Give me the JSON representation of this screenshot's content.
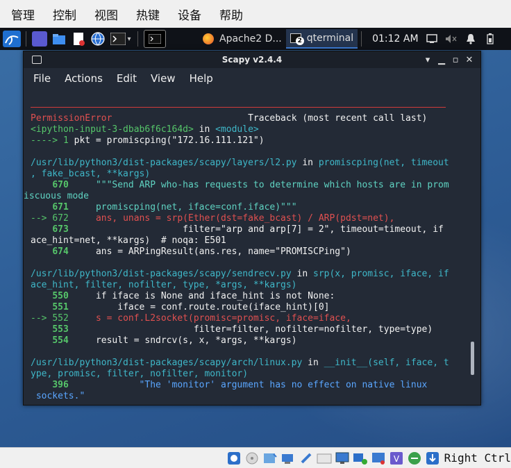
{
  "host_menu": {
    "items": [
      "管理",
      "控制",
      "视图",
      "热键",
      "设备",
      "帮助"
    ]
  },
  "panel": {
    "tasks": [
      {
        "label": "Apache2 D...",
        "icon": "firefox-icon"
      },
      {
        "label": "qterminal",
        "icon": "terminal-icon",
        "badge": "2"
      }
    ],
    "clock": "01:12 AM"
  },
  "window": {
    "title": "Scapy v2.4.4",
    "menu": [
      "File",
      "Actions",
      "Edit",
      "View",
      "Help"
    ]
  },
  "terminal": {
    "error_name": "PermissionError",
    "traceback_label": "Traceback (most recent call last)",
    "frames": [
      {
        "header": [
          "<ipython-input-3-dbab6f6c164d>",
          " in ",
          "<module>"
        ],
        "lines": [
          {
            "marker": "----> ",
            "num": "1",
            "code": "pkt = promiscping(\"172.16.111.121\")"
          }
        ]
      },
      {
        "path": "/usr/lib/python3/dist-packages/scapy/layers/l2.py",
        "func": "promiscping(net, timeout",
        "func_cont": ", fake_bcast, **kargs)",
        "lines": [
          {
            "marker": "    ",
            "num": "670",
            "code": "\"\"\"Send ARP who-has requests to determine which hosts are in prom"
          },
          {
            "marker": "",
            "num": "",
            "code": "iscuous mode"
          },
          {
            "marker": "    ",
            "num": "671",
            "code": "promiscping(net, iface=conf.iface)\"\"\""
          },
          {
            "marker": "--> ",
            "num": "672",
            "code": "ans, unans = srp(Ether(dst=fake_bcast) / ARP(pdst=net),"
          },
          {
            "marker": "    ",
            "num": "673",
            "code": "                filter=\"arp and arp[7] = 2\", timeout=timeout, if"
          },
          {
            "marker": "",
            "num": "",
            "code": "ace_hint=net, **kargs)  # noqa: E501"
          },
          {
            "marker": "    ",
            "num": "674",
            "code": "ans = ARPingResult(ans.res, name=\"PROMISCPing\")"
          }
        ]
      },
      {
        "path": "/usr/lib/python3/dist-packages/scapy/sendrecv.py",
        "func": "srp(x, promisc, iface, if",
        "func_cont": "ace_hint, filter, nofilter, type, *args, **kargs)",
        "lines": [
          {
            "marker": "    ",
            "num": "550",
            "code": "if iface is None and iface_hint is not None:"
          },
          {
            "marker": "    ",
            "num": "551",
            "code": "    iface = conf.route.route(iface_hint)[0]"
          },
          {
            "marker": "--> ",
            "num": "552",
            "code": "s = conf.L2socket(promisc=promisc, iface=iface,"
          },
          {
            "marker": "    ",
            "num": "553",
            "code": "                  filter=filter, nofilter=nofilter, type=type)"
          },
          {
            "marker": "    ",
            "num": "554",
            "code": "result = sndrcv(s, x, *args, **kargs)"
          }
        ]
      },
      {
        "path": "/usr/lib/python3/dist-packages/scapy/arch/linux.py",
        "func": "__init__(self, iface, t",
        "func_cont": "ype, promisc, filter, nofilter, monitor)",
        "lines": [
          {
            "marker": "    ",
            "num": "396",
            "code": "        \"The 'monitor' argument has no effect on native linux"
          },
          {
            "marker": "",
            "num": "",
            "code": " sockets.\""
          }
        ]
      }
    ]
  },
  "status_bar": {
    "host_key": "Right Ctrl"
  },
  "colors": {
    "accent": "#3d7cd6",
    "error": "#e05050",
    "string": "#5fd3c2",
    "lineno": "#56c66a"
  }
}
